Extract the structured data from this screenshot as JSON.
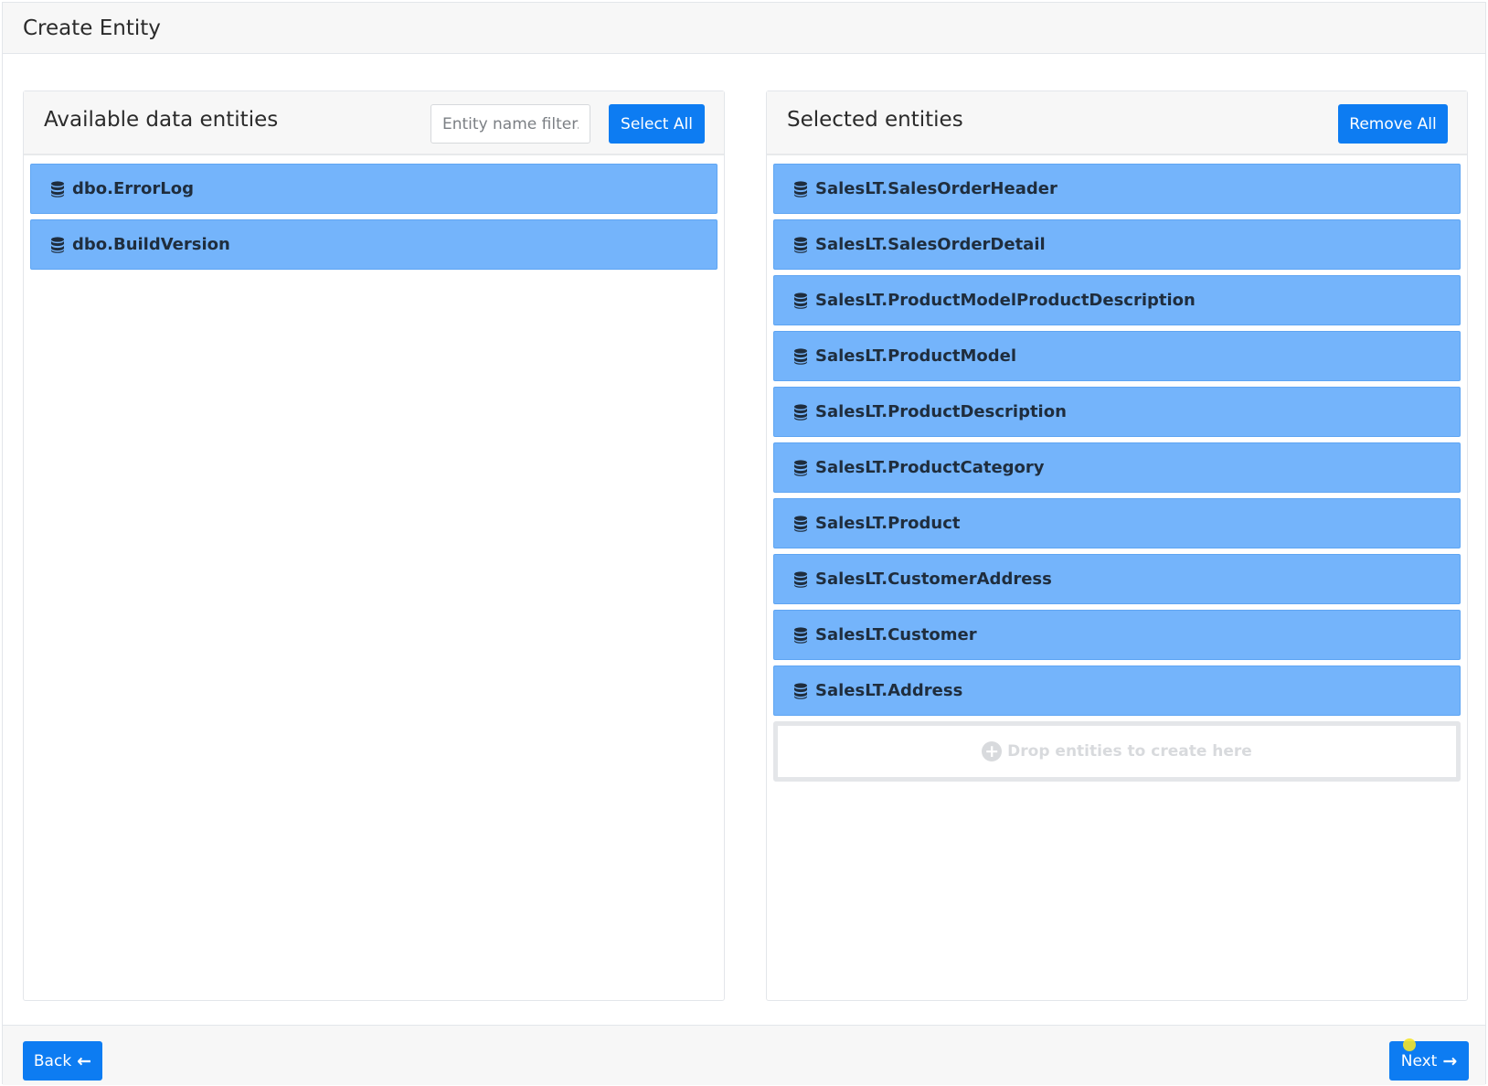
{
  "modal": {
    "title": "Create Entity"
  },
  "available": {
    "title": "Available data entities",
    "filter_placeholder": "Entity name filter..",
    "select_all_label": "Select All",
    "items": [
      {
        "label": "dbo.ErrorLog",
        "icon": "database-icon"
      },
      {
        "label": "dbo.BuildVersion",
        "icon": "database-icon"
      }
    ]
  },
  "selected": {
    "title": "Selected entities",
    "remove_all_label": "Remove All",
    "items": [
      {
        "label": "SalesLT.SalesOrderHeader",
        "icon": "database-icon"
      },
      {
        "label": "SalesLT.SalesOrderDetail",
        "icon": "database-icon"
      },
      {
        "label": "SalesLT.ProductModelProductDescription",
        "icon": "database-icon"
      },
      {
        "label": "SalesLT.ProductModel",
        "icon": "database-icon"
      },
      {
        "label": "SalesLT.ProductDescription",
        "icon": "database-icon"
      },
      {
        "label": "SalesLT.ProductCategory",
        "icon": "database-icon"
      },
      {
        "label": "SalesLT.Product",
        "icon": "database-icon"
      },
      {
        "label": "SalesLT.CustomerAddress",
        "icon": "database-icon"
      },
      {
        "label": "SalesLT.Customer",
        "icon": "database-icon"
      },
      {
        "label": "SalesLT.Address",
        "icon": "database-icon"
      }
    ],
    "drop_zone_label": "Drop entities to create here"
  },
  "footer": {
    "back_label": "Back",
    "next_label": "Next"
  },
  "colors": {
    "primary": "#0d7cf2",
    "entity_bg": "#74b4fb"
  }
}
